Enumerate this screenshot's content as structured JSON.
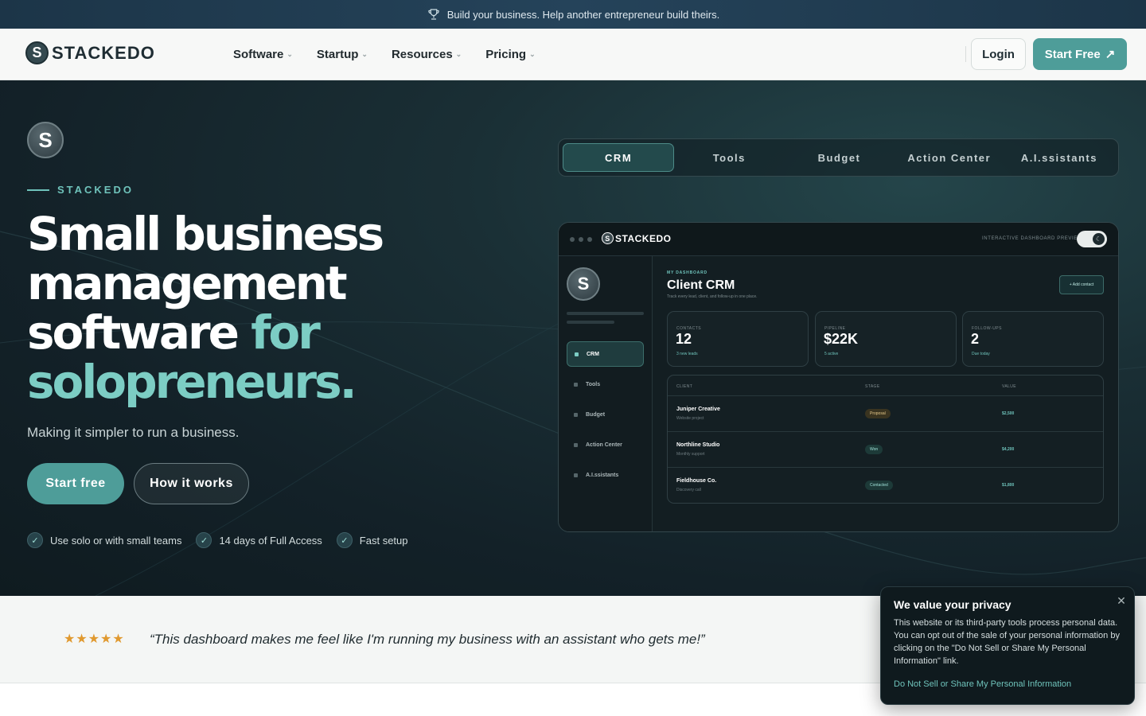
{
  "announcement": {
    "icon": "trophy-icon",
    "text": "Build your business. Help another entrepreneur build theirs."
  },
  "nav": {
    "brand": "STACKEDO",
    "brand_mark": "S",
    "menu": [
      {
        "label": "Software"
      },
      {
        "label": "Startup"
      },
      {
        "label": "Resources"
      },
      {
        "label": "Pricing"
      }
    ],
    "login_label": "Login",
    "start_label": "Start Free",
    "start_icon": "↗"
  },
  "hero": {
    "badge_mark": "S",
    "eyebrow": "STACKEDO",
    "headline_white": "Small business management software",
    "headline_accent_1": "for",
    "headline_accent_2": "solopreneurs.",
    "subhead": "Making it simpler to run a business.",
    "cta_primary": "Start free",
    "cta_secondary": "How it works",
    "checks": [
      {
        "label": "Use solo or with small teams"
      },
      {
        "label": "14 days of Full Access"
      },
      {
        "label": "Fast setup"
      }
    ]
  },
  "tabs": [
    {
      "label": "CRM",
      "active": true
    },
    {
      "label": "Tools"
    },
    {
      "label": "Budget"
    },
    {
      "label": "Action Center"
    },
    {
      "label": "A.I.ssistants"
    }
  ],
  "dashboard": {
    "brand": "STACKEDO",
    "preview_label": "INTERACTIVE DASHBOARD PREVIEW",
    "toggle_icon": "☾",
    "avatar_mark": "S",
    "sidebar": [
      {
        "label": "CRM",
        "active": true
      },
      {
        "label": "Tools"
      },
      {
        "label": "Budget"
      },
      {
        "label": "Action Center"
      },
      {
        "label": "A.I.ssistants"
      }
    ],
    "eyebrow": "MY DASHBOARD",
    "title": "Client CRM",
    "subtitle": "Track every lead, client, and follow-up in one place.",
    "add_button": "+ Add contact",
    "stats": [
      {
        "label": "CONTACTS",
        "value": "12",
        "note": "3 new leads"
      },
      {
        "label": "PIPELINE",
        "value": "$22K",
        "note": "5 active"
      },
      {
        "label": "FOLLOW-UPS",
        "value": "2",
        "note": "Due today"
      }
    ],
    "table": {
      "headers": [
        "CLIENT",
        "STAGE",
        "VALUE"
      ],
      "rows": [
        {
          "name": "Juniper Creative",
          "sub": "Website project",
          "stage": "Proposal",
          "value": "$2,500"
        },
        {
          "name": "Northline Studio",
          "sub": "Monthly support",
          "stage": "Won",
          "value": "$4,200"
        },
        {
          "name": "Fieldhouse Co.",
          "sub": "Discovery call",
          "stage": "Contacted",
          "value": "$1,800"
        }
      ]
    }
  },
  "testimonial": {
    "stars": "★★★★★",
    "quote": "“This dashboard makes me feel like I'm running my business with an assistant who gets me!”"
  },
  "privacy": {
    "title": "We value your privacy",
    "body": "This website or its third-party tools process personal data. You can opt out of the sale of your personal information by clicking on the \"Do Not Sell or Share My Personal Information\" link.",
    "link": "Do Not Sell or Share My Personal Information",
    "close_icon": "close-icon"
  },
  "colors": {
    "accent": "#4e9d99",
    "accent_light": "#7ccdc4",
    "hero_bg": "#132128",
    "star": "#e0992f"
  }
}
